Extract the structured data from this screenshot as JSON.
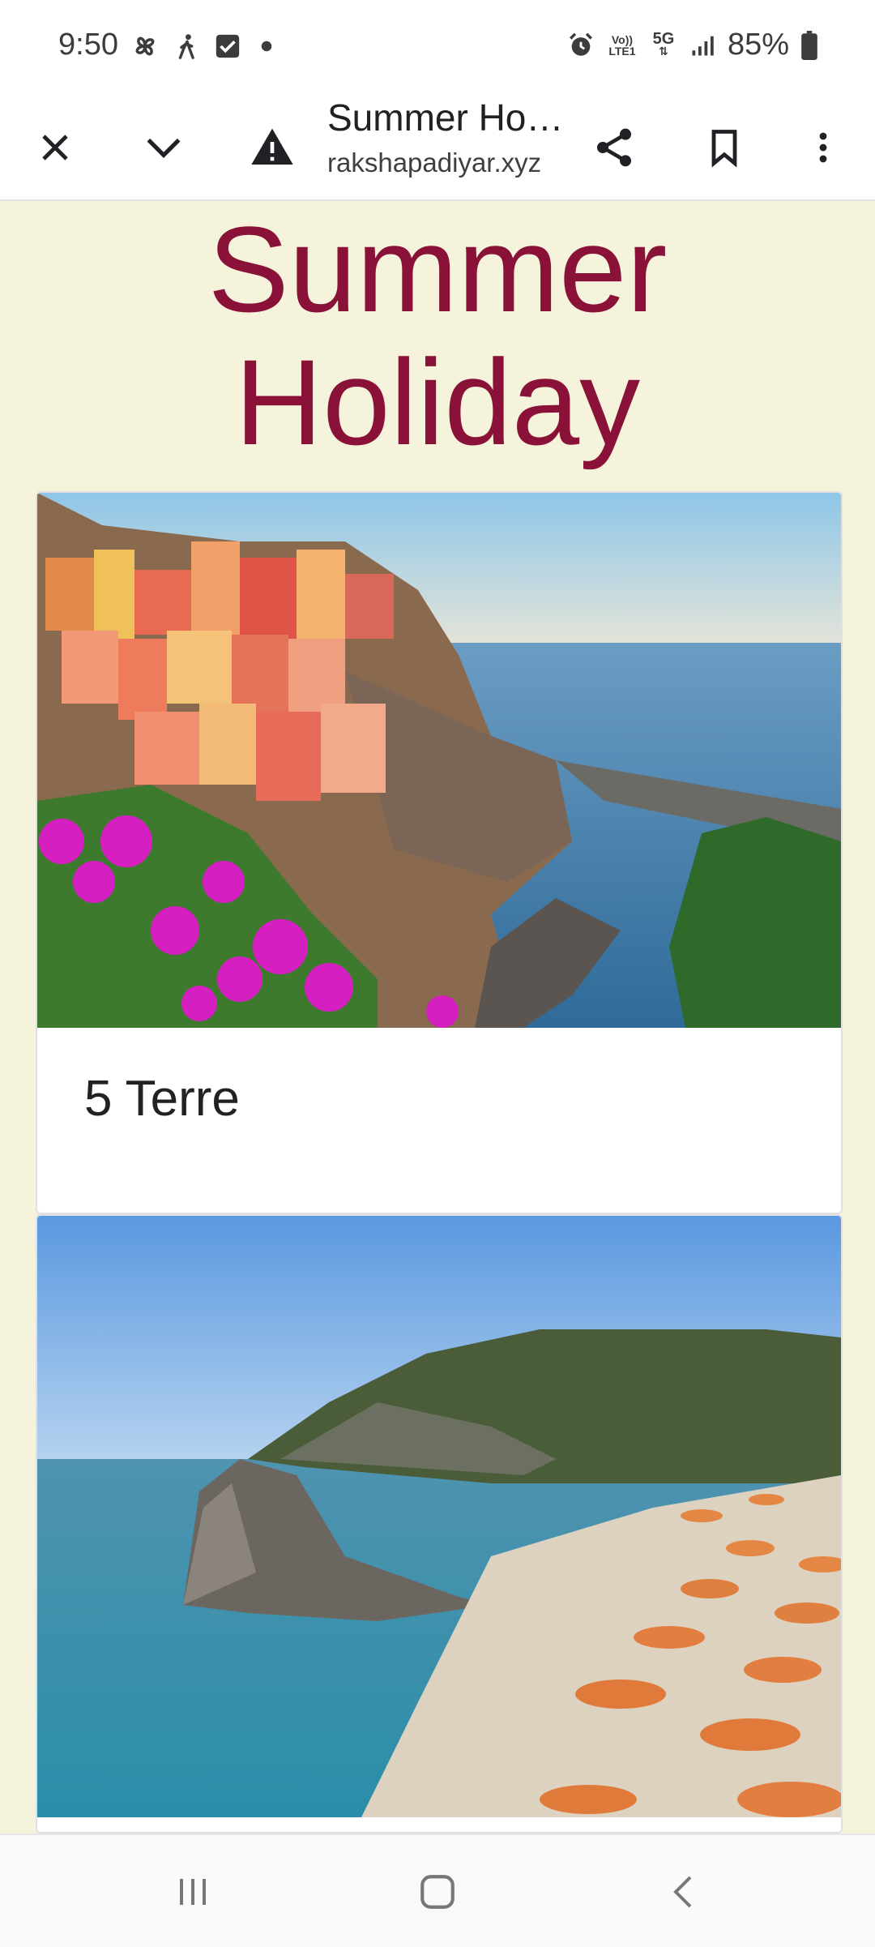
{
  "status_bar": {
    "time": "9:50",
    "battery": "85%",
    "network_label": "5G",
    "volte_label": "Vo)) LTE1",
    "left_icons": [
      "fan-icon",
      "walking-icon",
      "checkbox-icon",
      "dot-icon"
    ],
    "right_icons": [
      "alarm-icon",
      "volte-icon",
      "5g-icon",
      "signal-icon",
      "battery-icon"
    ]
  },
  "toolbar": {
    "tab_title": "Summer Ho…",
    "url": "rakshapadiyar.xyz",
    "icons": [
      "close-icon",
      "chevron-down-icon",
      "warning-icon",
      "share-icon",
      "bookmark-icon",
      "more-vert-icon"
    ]
  },
  "page": {
    "headline": "Summer Holiday",
    "cards": [
      {
        "caption": "5 Terre"
      },
      {
        "caption": ""
      }
    ]
  },
  "nav_bar": {
    "icons": [
      "recent-apps-icon",
      "home-icon",
      "back-icon"
    ]
  },
  "colors": {
    "headline": "#8a1238",
    "page_background": "#f5f3dc",
    "card_background": "#ffffff"
  }
}
